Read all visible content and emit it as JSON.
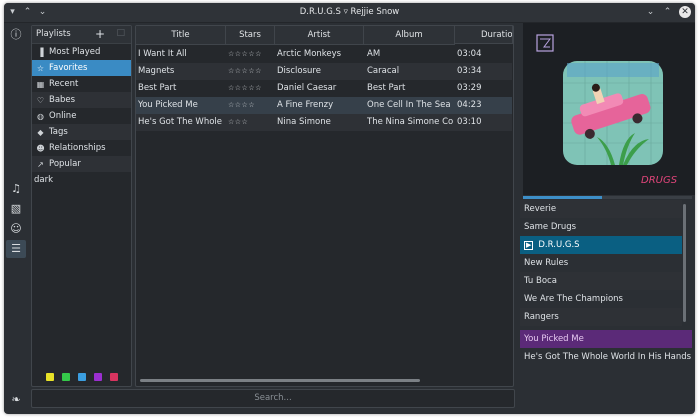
{
  "window": {
    "title": "D.R.U.G.S ▿ Rejjie Snow"
  },
  "sidebar_icons": [
    {
      "name": "info-icon",
      "glyph": "ⓘ"
    },
    {
      "name": "music-note-icon",
      "glyph": "♫"
    },
    {
      "name": "album-icon",
      "glyph": "▧"
    },
    {
      "name": "artist-icon",
      "glyph": "☺"
    },
    {
      "name": "playlist-icon",
      "glyph": "☰"
    },
    {
      "name": "rabbit-icon",
      "glyph": "❧"
    }
  ],
  "playlists": {
    "title": "Playlists",
    "add": "+",
    "delete": "□",
    "items": [
      {
        "label": "Most Played",
        "icon": "bar-chart-icon",
        "glyph": "▐"
      },
      {
        "label": "Favorites",
        "icon": "star-icon",
        "glyph": "☆"
      },
      {
        "label": "Recent",
        "icon": "calendar-icon",
        "glyph": "▦"
      },
      {
        "label": "Babes",
        "icon": "heart-icon",
        "glyph": "♡"
      },
      {
        "label": "Online",
        "icon": "globe-icon",
        "glyph": "◍"
      },
      {
        "label": "Tags",
        "icon": "tag-icon",
        "glyph": "◆"
      },
      {
        "label": "Relationships",
        "icon": "users-icon",
        "glyph": "☻"
      },
      {
        "label": "Popular",
        "icon": "line-chart-icon",
        "glyph": "↗"
      }
    ],
    "extra": "dark",
    "swatches": [
      "#e8e228",
      "#35c94a",
      "#3b9ee0",
      "#9b2fd0",
      "#d8345f"
    ]
  },
  "tracks": {
    "columns": [
      "Title",
      "Stars",
      "Artist",
      "Album",
      "Duration"
    ],
    "rows": [
      {
        "title": "I Want It All",
        "stars": "☆☆☆☆☆",
        "artist": "Arctic Monkeys",
        "album": "AM",
        "duration": "03:04"
      },
      {
        "title": "Magnets",
        "stars": "☆☆☆☆☆",
        "artist": "Disclosure",
        "album": "Caracal",
        "duration": "03:34"
      },
      {
        "title": "Best Part",
        "stars": "☆☆☆☆☆",
        "artist": "Daniel Caesar",
        "album": "Best Part",
        "duration": "03:29"
      },
      {
        "title": "You Picked Me",
        "stars": "☆☆☆☆",
        "artist": "A Fine Frenzy",
        "album": "One Cell In The Sea",
        "duration": "04:23"
      },
      {
        "title": "He's Got The Whole ...",
        "stars": "☆☆☆",
        "artist": "Nina Simone",
        "album": "The Nina Simone Coll...",
        "duration": "03:10"
      }
    ]
  },
  "album_art": {
    "caption": "DRUGS"
  },
  "progress_fraction": 0.47,
  "queue": {
    "items": [
      "Reverie",
      "Same Drugs",
      "D.R.U.G.S",
      "New Rules",
      "Tu Boca",
      "We Are The Champions",
      "Rangers"
    ],
    "playing_glyph": "▶",
    "history": [
      "You Picked Me",
      "He's Got The Whole World In His Hands"
    ]
  },
  "search": {
    "placeholder": "Search..."
  }
}
